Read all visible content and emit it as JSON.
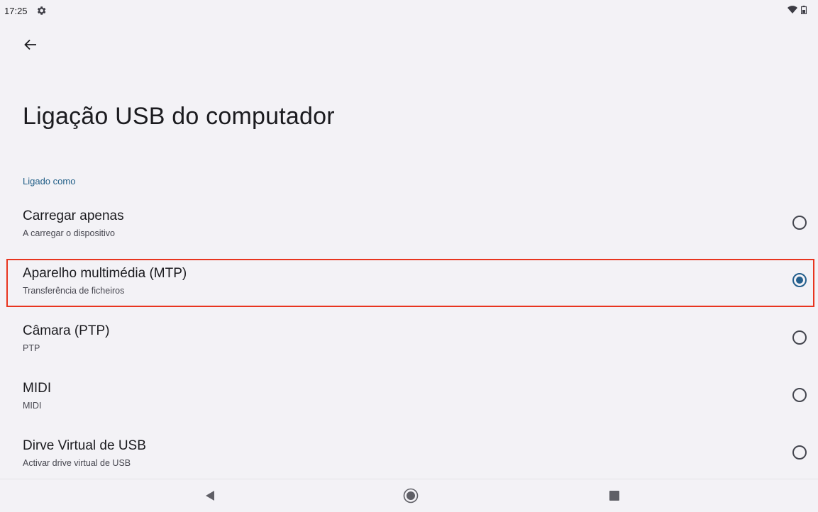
{
  "status_bar": {
    "time": "17:25",
    "icons": [
      "gear-icon",
      "wifi-icon",
      "battery-icon"
    ]
  },
  "toolbar": {
    "back_icon": "arrow-back-icon"
  },
  "page": {
    "title": "Ligação USB do computador",
    "section_header": "Ligado como"
  },
  "options": [
    {
      "title": "Carregar apenas",
      "subtitle": "A carregar o dispositivo",
      "selected": false
    },
    {
      "title": "Aparelho multimédia (MTP)",
      "subtitle": "Transferência de ficheiros",
      "selected": true
    },
    {
      "title": "Câmara (PTP)",
      "subtitle": "PTP",
      "selected": false
    },
    {
      "title": "MIDI",
      "subtitle": "MIDI",
      "selected": false
    },
    {
      "title": "Dirve Virtual de USB",
      "subtitle": "Activar drive virtual de USB",
      "selected": false
    }
  ],
  "nav_bar": {
    "icons": [
      "nav-back-icon",
      "nav-home-icon",
      "nav-recents-icon"
    ]
  },
  "colors": {
    "accent": "#245f8d",
    "highlight_border": "#e8351f",
    "background": "#f3f2f6"
  }
}
